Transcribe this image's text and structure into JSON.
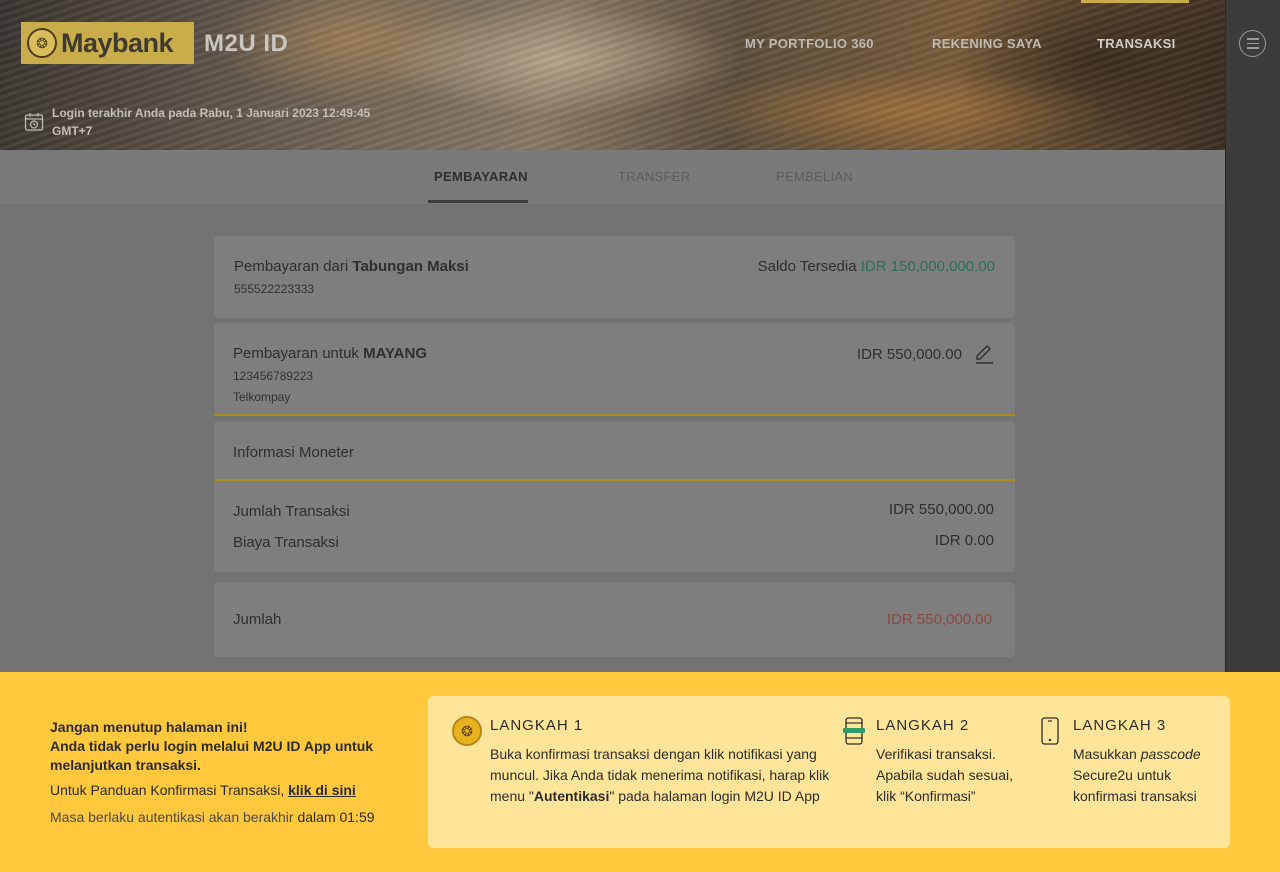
{
  "header": {
    "logo_text": "Maybank",
    "app_name": "M2U ID",
    "nav": [
      "MY PORTFOLIO 360",
      "REKENING SAYA",
      "TRANSAKSI"
    ],
    "login_line1": "Login terakhir Anda pada Rabu, 1 Januari 2023 12:49:45",
    "login_line2": "GMT+7"
  },
  "subnav": {
    "tabs": [
      "PEMBAYARAN",
      "TRANSFER",
      "PEMBELIAN"
    ]
  },
  "from_card": {
    "prefix": "Pembayaran dari ",
    "account_name": "Tabungan Maksi",
    "account_number": "555522223333",
    "balance_label": "Saldo Tersedia ",
    "balance_value": "IDR 150,000,000.00"
  },
  "to_card": {
    "prefix": "Pembayaran untuk ",
    "payee_name": "MAYANG",
    "payee_number": "123456789223",
    "biller": "Telkompay",
    "amount": "IDR 550,000.00"
  },
  "info_card": {
    "title": "Informasi Moneter",
    "rows": [
      {
        "label": "Jumlah Transaksi",
        "value": "IDR 550,000.00"
      },
      {
        "label": "Biaya Transaksi",
        "value": "IDR 0.00"
      }
    ]
  },
  "total_card": {
    "label": "Jumlah",
    "value": "IDR 550,000.00"
  },
  "banner": {
    "warning_line1": "Jangan menutup halaman ini!",
    "warning_line2": "Anda tidak perlu login melalui M2U ID App untuk melanjutkan transaksi.",
    "guide_text": "Untuk Panduan Konfirmasi Transaksi, ",
    "guide_link": "klik di sini",
    "expire_text": "Masa berlaku autentikasi akan berakhir ",
    "expire_time": "dalam 01:59",
    "steps": [
      {
        "title": "LANGKAH 1",
        "body_part1": "Buka konfirmasi transaksi dengan klik notifikasi yang muncul. Jika Anda tidak menerima notifikasi, harap klik menu \"",
        "body_bold": "Autentikasi",
        "body_part2": "\" pada halaman login M2U ID App"
      },
      {
        "title": "LANGKAH 2",
        "body": "Verifikasi transaksi. Apabila sudah sesuai, klik “Konfirmasi”"
      },
      {
        "title": "LANGKAH 3",
        "body_part1": "Masukkan ",
        "body_italic": "passcode",
        "body_part2": " Secure2u untuk konfirmasi transaksi"
      }
    ]
  },
  "colors": {
    "brand_gold": "#c9ad4a",
    "banner_yellow": "#ffc83d",
    "balance_green": "#2d8a6e",
    "total_red": "#b3413a"
  }
}
